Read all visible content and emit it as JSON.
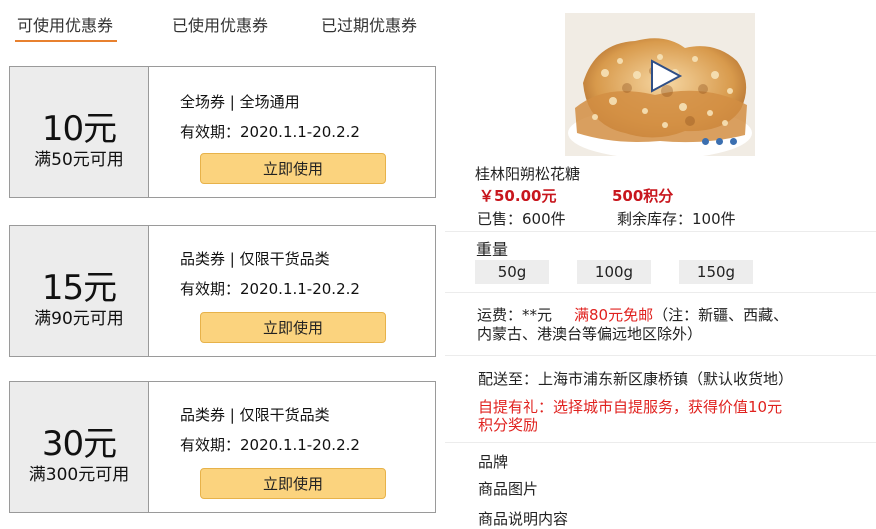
{
  "tabs": [
    "可使用优惠券",
    "已使用优惠券",
    "已过期优惠券"
  ],
  "coupons": [
    {
      "amount": "10元",
      "condition": "满50元可用",
      "type": "全场券 | 全场通用",
      "validity": "有效期：2020.1.1-20.2.2",
      "button": "立即使用"
    },
    {
      "amount": "15元",
      "condition": "满90元可用",
      "type": "品类券 | 仅限干货品类",
      "validity": "有效期：2020.1.1-20.2.2",
      "button": "立即使用"
    },
    {
      "amount": "30元",
      "condition": "满300元可用",
      "type": "品类券 | 仅限干货品类",
      "validity": "有效期：2020.1.1-20.2.2",
      "button": "立即使用"
    }
  ],
  "product": {
    "name": "桂林阳朔松花糖",
    "price": "￥50.00元",
    "points": "500积分",
    "sold": "已售：600件",
    "stock": "剩余库存：100件",
    "weight_label": "重量",
    "weight_options": [
      "50g",
      "100g",
      "150g"
    ],
    "shipping_prefix": "运费：**元",
    "shipping_free": "满80元免邮",
    "shipping_note_1": "（注：新疆、西藏、",
    "shipping_note_2": "内蒙古、港澳台等偏远地区除外）",
    "delivery": "配送至：上海市浦东新区康桥镇（默认收货地）",
    "pickup_1": "自提有礼：选择城市自提服务，获得价值10元",
    "pickup_2": "积分奖励",
    "brand": "品牌",
    "images": "商品图片",
    "description": "商品说明内容"
  },
  "colors": {
    "accent_underline": "#e8812f",
    "button_bg": "#fbd37e",
    "price_red": "#c8161d",
    "highlight_red": "#e0221f"
  }
}
